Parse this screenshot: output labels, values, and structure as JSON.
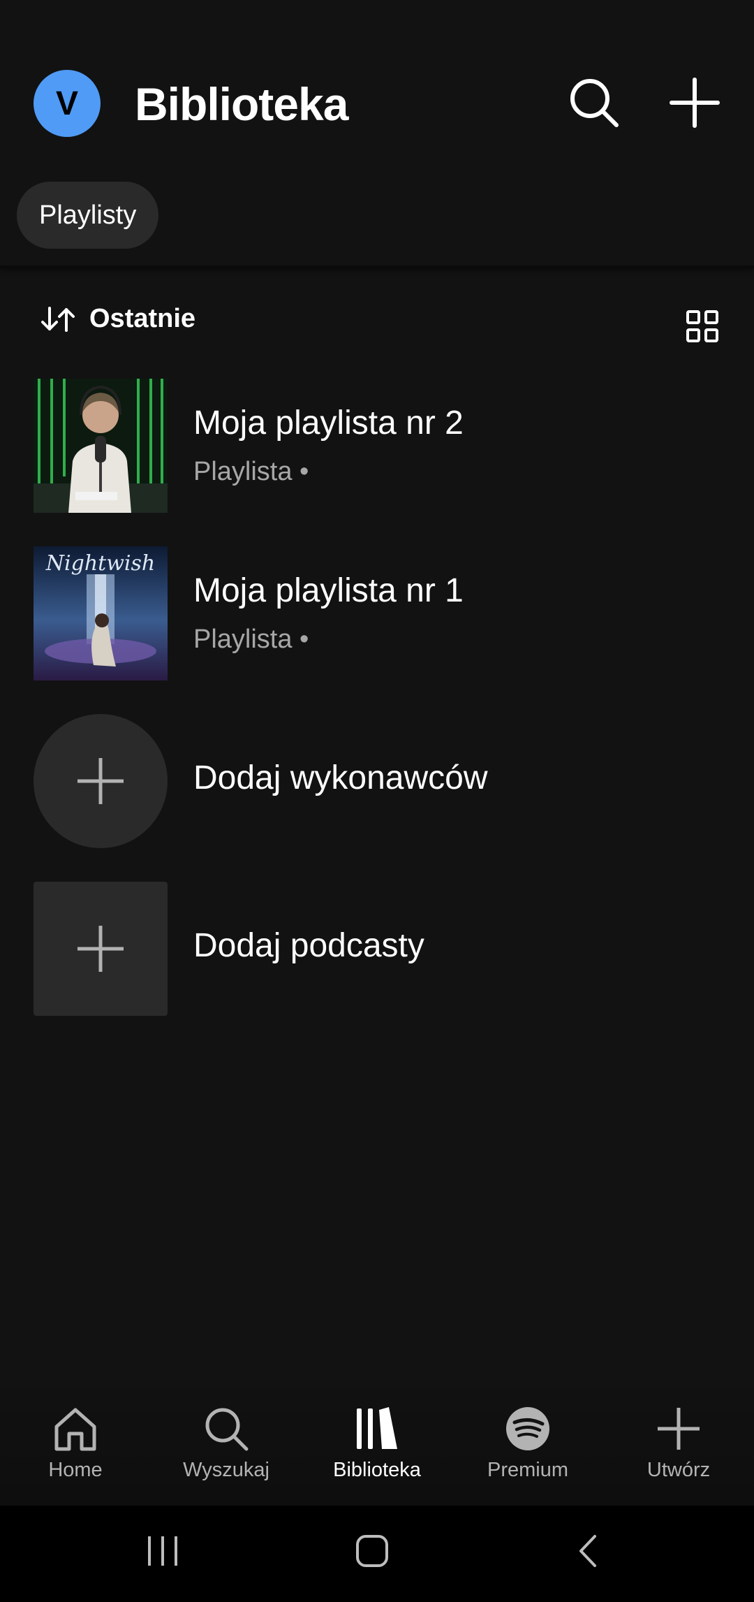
{
  "header": {
    "avatar_letter": "V",
    "title": "Biblioteka",
    "filter_chip": "Playlisty"
  },
  "sort": {
    "label": "Ostatnie"
  },
  "library": {
    "items": [
      {
        "title": "Moja playlista nr 2",
        "subtitle": "Playlista •"
      },
      {
        "title": "Moja playlista nr 1",
        "subtitle": "Playlista •"
      }
    ],
    "add_artists": "Dodaj wykonawców",
    "add_podcasts": "Dodaj podcasty",
    "album_text": "Nightwish"
  },
  "bottom_nav": {
    "home": "Home",
    "search": "Wyszukaj",
    "library": "Biblioteka",
    "premium": "Premium",
    "create": "Utwórz"
  },
  "colors": {
    "background": "#121212",
    "avatar": "#509bf5",
    "chip": "#2a2a2a",
    "subtext": "#a7a7a7"
  }
}
